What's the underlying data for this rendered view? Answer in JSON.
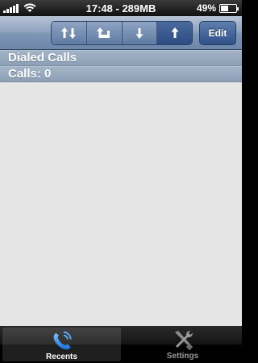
{
  "status_bar": {
    "time_memory": "17:48 - 289MB",
    "battery_percent": "49%",
    "battery_level": 0.49,
    "signal_bars": 5
  },
  "toolbar": {
    "segments": [
      {
        "icon": "up-down-arrows-icon",
        "selected": false
      },
      {
        "icon": "return-arrow-icon",
        "selected": false
      },
      {
        "icon": "down-arrow-icon",
        "selected": false
      },
      {
        "icon": "up-arrow-icon",
        "selected": true
      }
    ],
    "edit_label": "Edit"
  },
  "main": {
    "section_title": "Dialed Calls",
    "calls_count": "Calls: 0"
  },
  "tabs": [
    {
      "label": "Recents",
      "icon": "phone-icon",
      "active": true
    },
    {
      "label": "Settings",
      "icon": "tools-icon",
      "active": false
    }
  ],
  "colors": {
    "nav_blue": "#7f96b5",
    "selected_segment": "#2b4c83",
    "content_background": "#e5e5e5"
  }
}
